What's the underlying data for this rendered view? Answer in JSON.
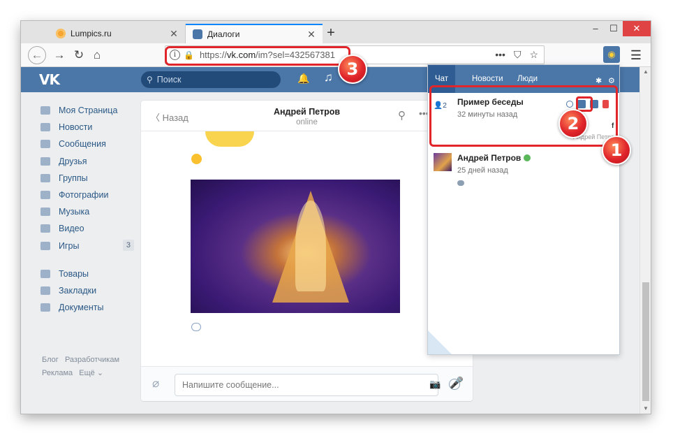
{
  "browser": {
    "tabs": [
      {
        "title": "Lumpics.ru",
        "active": false,
        "favicon": "orange-circle-icon"
      },
      {
        "title": "Диалоги",
        "active": true,
        "favicon": "vk-message-icon"
      }
    ],
    "new_tab": "+",
    "url_prefix": "https://",
    "url_host": "vk.com",
    "url_path": "/im?sel=432567381",
    "accent": "#0a84ff"
  },
  "vk": {
    "logo": "VK",
    "search_placeholder": "Поиск",
    "brand_color": "#4a76a8",
    "menu": [
      {
        "label": "Моя Страница",
        "icon": "home-icon"
      },
      {
        "label": "Новости",
        "icon": "news-icon"
      },
      {
        "label": "Сообщения",
        "icon": "messages-icon"
      },
      {
        "label": "Друзья",
        "icon": "friends-icon"
      },
      {
        "label": "Группы",
        "icon": "groups-icon"
      },
      {
        "label": "Фотографии",
        "icon": "camera-icon"
      },
      {
        "label": "Музыка",
        "icon": "music-icon"
      },
      {
        "label": "Видео",
        "icon": "video-icon"
      },
      {
        "label": "Игры",
        "icon": "games-icon",
        "badge": "3"
      }
    ],
    "menu2": [
      {
        "label": "Товары",
        "icon": "bag-icon"
      },
      {
        "label": "Закладки",
        "icon": "star-icon"
      },
      {
        "label": "Документы",
        "icon": "document-icon"
      }
    ],
    "footer": {
      "blog": "Блог",
      "dev": "Разработчикам",
      "ads": "Реклама",
      "more": "Ещё ⌄"
    }
  },
  "chat": {
    "back_label": "Назад",
    "name": "Андрей Петров",
    "status": "online",
    "input_placeholder": "Напишите сообщение..."
  },
  "popup": {
    "tabs": [
      "Чат",
      "Новости",
      "Люди"
    ],
    "conversations": [
      {
        "title": "Пример беседы",
        "time": "32 минуты назад",
        "members": "2",
        "author": "Андрей Петров",
        "extra": "f"
      },
      {
        "title": "Андрей Петров",
        "time": "25 дней назад"
      }
    ]
  },
  "annotations": {
    "one": "1",
    "two": "2",
    "three": "3",
    "color": "#e0252b"
  }
}
